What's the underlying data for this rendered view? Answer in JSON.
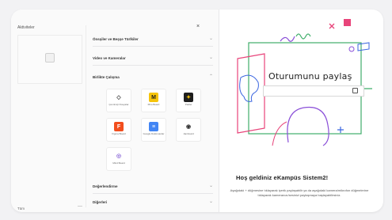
{
  "panel": {
    "title": "Aktiviteler",
    "footer_label": "Tüm",
    "footer_dash": "—",
    "close_label": "×"
  },
  "sections": [
    {
      "label": "Önsşiler ve Beşşe Türlkiler",
      "chevron": "⌄"
    },
    {
      "label": "Video ve Kameralar",
      "chevron": "⌄"
    },
    {
      "label": "Birlikte Çalışma",
      "chevron": "⌃"
    },
    {
      "label": "Değerlendirme",
      "chevron": "⌄"
    },
    {
      "label": "Diğerleri",
      "chevron": "⌄"
    }
  ],
  "tools": [
    {
      "label": "Çevrimiçi Dosyalar",
      "icon": "shapes-icon",
      "color": "#3a3a3a",
      "glyph": "◇"
    },
    {
      "label": "Miro Board",
      "icon": "miro-icon",
      "color": "#f6c40a",
      "glyph": "M"
    },
    {
      "label": "Padlet",
      "icon": "padlet-icon",
      "color": "#1e1e1e",
      "glyph": "✦"
    },
    {
      "label": "Figma Board",
      "icon": "figma-icon",
      "color": "#f24e1e",
      "glyph": "F"
    },
    {
      "label": "Google Dokümanlar",
      "icon": "docs-icon",
      "color": "#4285f4",
      "glyph": "≡"
    },
    {
      "label": "Jamboard",
      "icon": "jamboard-icon",
      "color": "#333333",
      "glyph": "◉"
    },
    {
      "label": "Mind Board",
      "icon": "mind-board-icon",
      "color": "#8c6ad8",
      "glyph": "◎"
    }
  ],
  "main": {
    "share_title": "Oturumunu paylaş",
    "welcome_title": "Hoş geldiniz eKampüs Sistem2!",
    "welcome_body": "Aşağıdaki + düğmesine tıklayarak içerik paylaşabilir ya da aşağıdaki kamera/mikrofon düğmelerine tıklayarak kameranızı/sesinizi paylaşmaya başlayabilirsiniz."
  },
  "colors": {
    "accent_pink": "#e8447a",
    "accent_blue": "#3b66e0",
    "accent_green": "#3fae6a",
    "accent_purple": "#8a4fd8"
  }
}
